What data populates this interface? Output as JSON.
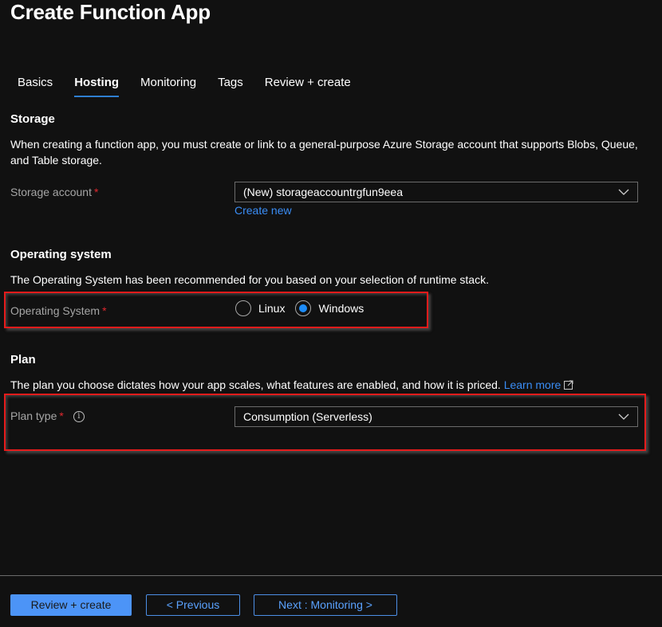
{
  "header": {
    "title": "Create Function App"
  },
  "tabs": [
    {
      "label": "Basics",
      "active": false
    },
    {
      "label": "Hosting",
      "active": true
    },
    {
      "label": "Monitoring",
      "active": false
    },
    {
      "label": "Tags",
      "active": false
    },
    {
      "label": "Review + create",
      "active": false
    }
  ],
  "storage": {
    "heading": "Storage",
    "description": "When creating a function app, you must create or link to a general-purpose Azure Storage account that supports Blobs, Queue, and Table storage.",
    "field_label": "Storage account",
    "required_mark": "*",
    "selected_value": "(New) storageaccountrgfun9eea",
    "create_new_link": "Create new"
  },
  "operating_system": {
    "heading": "Operating system",
    "description": "The Operating System has been recommended for you based on your selection of runtime stack.",
    "field_label": "Operating System",
    "required_mark": "*",
    "options": [
      {
        "label": "Linux",
        "checked": false
      },
      {
        "label": "Windows",
        "checked": true
      }
    ]
  },
  "plan": {
    "heading": "Plan",
    "description": "The plan you choose dictates how your app scales, what features are enabled, and how it is priced.",
    "learn_more_link": "Learn more",
    "field_label": "Plan type",
    "required_mark": "*",
    "info_icon": "i",
    "selected_value": "Consumption (Serverless)"
  },
  "footer": {
    "review_create_label": "Review + create",
    "previous_label": "< Previous",
    "next_label": "Next : Monitoring >"
  },
  "colors": {
    "background": "#111111",
    "accent": "#4c94f7",
    "link": "#3a8df5",
    "required": "#e0282e",
    "highlight_border": "#e51b1b"
  }
}
